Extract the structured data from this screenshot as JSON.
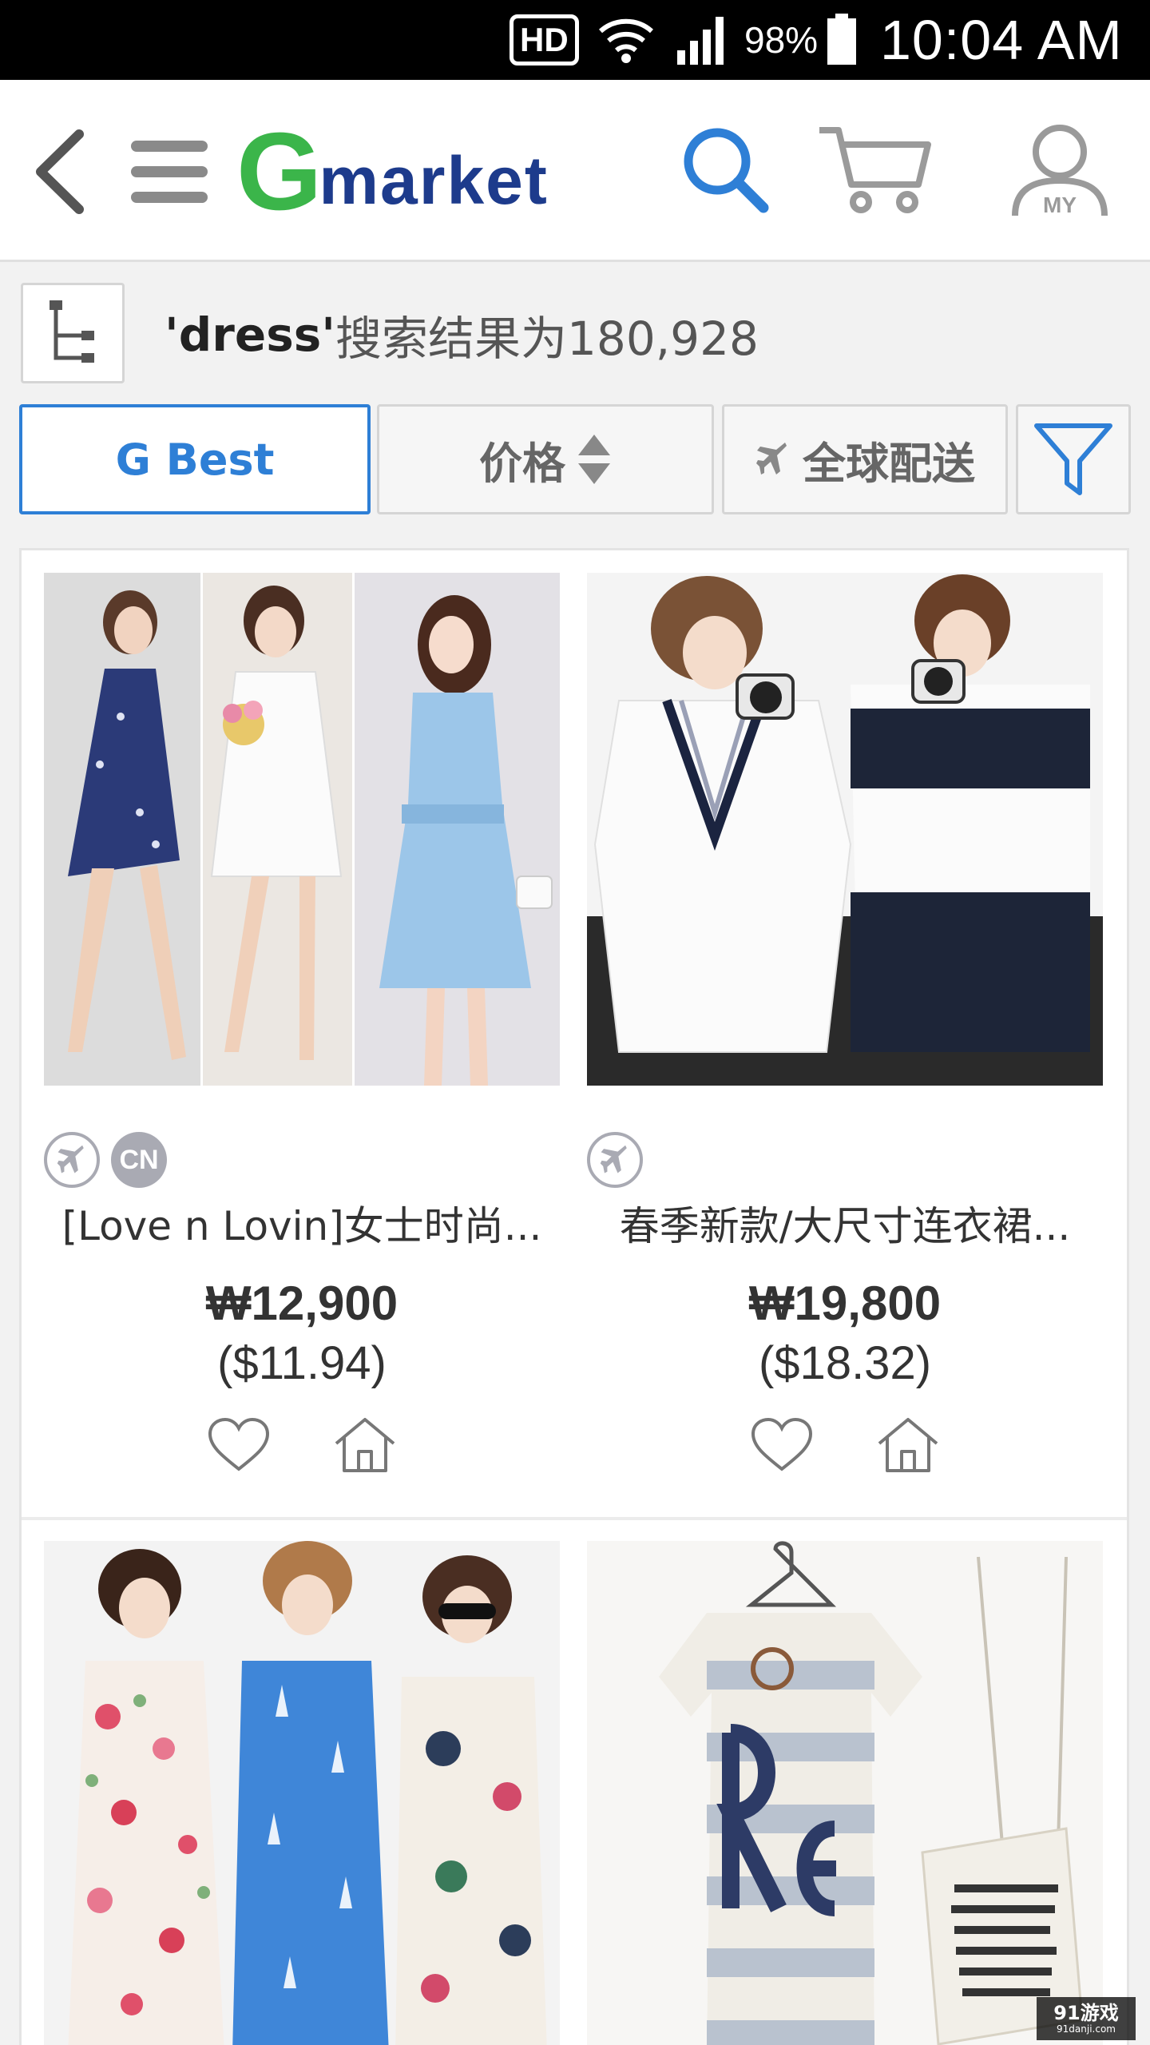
{
  "status_bar": {
    "hd": "HD",
    "battery_pct": "98%",
    "time": "10:04 AM"
  },
  "header": {
    "logo_g": "G",
    "logo_rest": "market",
    "icons": [
      "back-icon",
      "menu-icon",
      "search-icon",
      "cart-icon",
      "my-account-icon"
    ],
    "my_label": "MY"
  },
  "results": {
    "query": "'dress'",
    "summary": "搜索结果为180,928"
  },
  "filters": {
    "g_best": "G Best",
    "price": "价格",
    "global_shipping": "全球配送"
  },
  "products": [
    {
      "title": "[Love n Lovin]女士时尚...",
      "price_krw": "₩12,900",
      "price_usd": "($11.94)",
      "badges": [
        "plane",
        "CN"
      ]
    },
    {
      "title": "春季新款/大尺寸连衣裙...",
      "price_krw": "₩19,800",
      "price_usd": "($18.32)",
      "badges": [
        "plane"
      ]
    },
    {
      "title": "",
      "price_krw": "",
      "price_usd": "",
      "badges": []
    },
    {
      "title": "",
      "price_krw": "",
      "price_usd": "",
      "badges": []
    }
  ],
  "colors": {
    "accent_blue": "#2e7fd6",
    "logo_green": "#3bb54a",
    "logo_navy": "#1d3b8c",
    "badge_gray": "#a9aab3"
  },
  "watermark": {
    "main": "91游戏",
    "sub": "91danji.com"
  }
}
